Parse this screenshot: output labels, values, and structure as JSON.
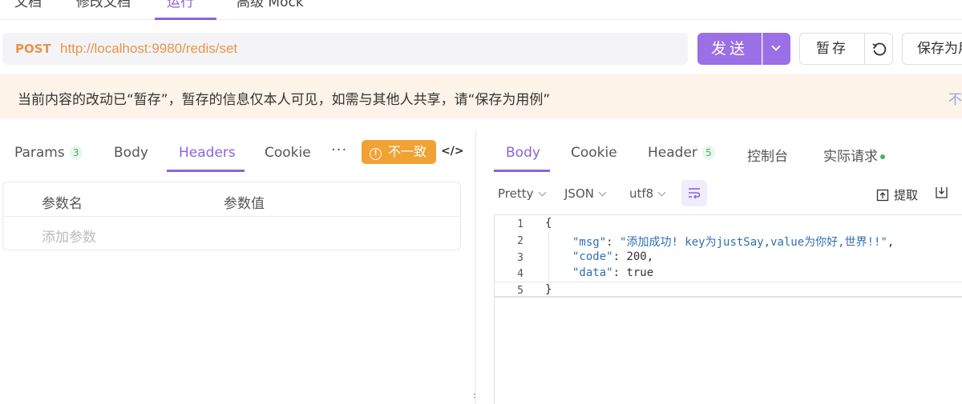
{
  "top_tabs": [
    {
      "label": "文档",
      "active": false
    },
    {
      "label": "修改文档",
      "active": false
    },
    {
      "label": "运行",
      "active": true
    },
    {
      "label": "高级 Mock",
      "active": false
    }
  ],
  "request": {
    "method": "POST",
    "url": "http://localhost:9980/redis/set"
  },
  "actions": {
    "send_label": "发送",
    "temp_save_label": "暂存",
    "save_as_label": "保存为用例"
  },
  "notice": {
    "text": "当前内容的改动已“暂存”，暂存的信息仅本人可见，如需与其他人共享，请“保存为用例”",
    "link": "不再提示"
  },
  "request_tabs": {
    "params_label": "Params",
    "params_count": "3",
    "body_label": "Body",
    "headers_label": "Headers",
    "cookies_label": "Cookies",
    "more": "···",
    "mismatch_label": "不一致",
    "code_label": "</>"
  },
  "param_table": {
    "col_name": "参数名",
    "col_value": "参数值",
    "add_placeholder": "添加参数"
  },
  "response_tabs": {
    "body_label": "Body",
    "cookie_label": "Cookie",
    "header_label": "Header",
    "header_count": "5",
    "console_label": "控制台",
    "actual_label": "实际请求"
  },
  "response_toolbar": {
    "format": "Pretty",
    "type": "JSON",
    "encoding": "utf8",
    "extract_label": "提取"
  },
  "response_body": {
    "line_numbers": [
      "1",
      "2",
      "3",
      "4",
      "5"
    ],
    "msg_key": "\"msg\"",
    "msg_value": "\"添加成功! key为justSay,value为你好,世界!!\"",
    "code_key": "\"code\"",
    "code_value": "200",
    "data_key": "\"data\"",
    "data_value": "true",
    "open_brace": "{",
    "close_brace": "}"
  },
  "colors": {
    "accent": "#8a63e0",
    "send": "#9b6fe6",
    "method": "#e8944a",
    "mismatch": "#f2a134",
    "notice_bg": "#fdf3e8"
  }
}
